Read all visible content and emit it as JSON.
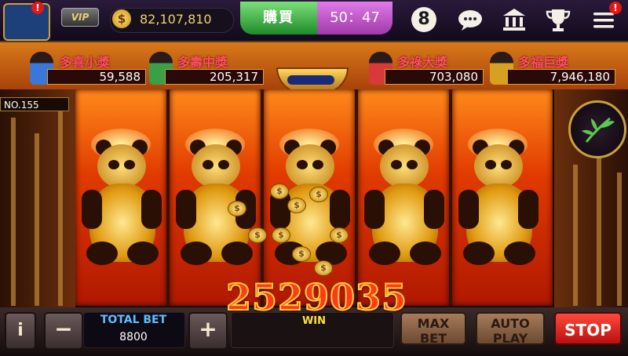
{
  "header": {
    "vip_label": "VIP",
    "balance": "82,107,810",
    "coin_symbol": "$",
    "buy_label": "購買",
    "timer": "50：47",
    "notification_badge": "!",
    "ball_label": "8"
  },
  "jackpots": [
    {
      "name": "多喜小獎",
      "value": "59,588"
    },
    {
      "name": "多壽中獎",
      "value": "205,317"
    },
    {
      "name": "多祿大獎",
      "value": "703,080"
    },
    {
      "name": "多福巨獎",
      "value": "7,946,180"
    }
  ],
  "reel_panel": {
    "number_label": "NO.155"
  },
  "reels": {
    "count": 5,
    "symbol": "golden-panda"
  },
  "win": {
    "amount": "2529035",
    "label": "WIN"
  },
  "controls": {
    "info_label": "i",
    "minus_label": "−",
    "plus_label": "+",
    "total_bet_label": "TOTAL BET",
    "total_bet_value": "8800",
    "max_bet_label_1": "MAX",
    "max_bet_label_2": "BET",
    "auto_play_label_1": "AUTO",
    "auto_play_label_2": "PLAY",
    "stop_label": "STOP"
  },
  "icons": {
    "chat": "chat-icon",
    "bank": "bank-icon",
    "trophy": "trophy-icon",
    "menu": "menu-icon",
    "bamboo": "bamboo-icon"
  },
  "colors": {
    "buy_green": "#1f8a2a",
    "timer_purple": "#a03aa8",
    "stop_red": "#b81010",
    "win_text": "#ff3a1a",
    "total_bet_label": "#5cc0ff"
  }
}
